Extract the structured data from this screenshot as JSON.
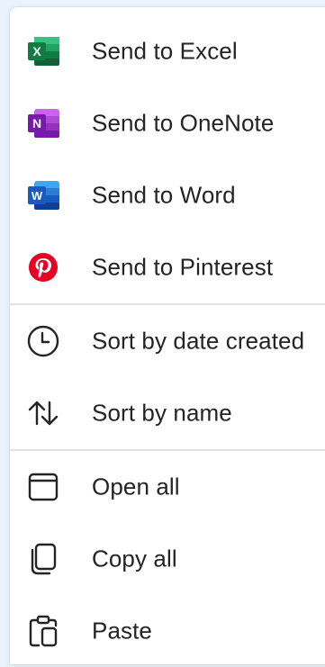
{
  "menu": {
    "items": [
      {
        "label": "Send to Excel",
        "icon": "excel-icon",
        "color": "#107c41"
      },
      {
        "label": "Send to OneNote",
        "icon": "onenote-icon",
        "color": "#7719aa"
      },
      {
        "label": "Send to Word",
        "icon": "word-icon",
        "color": "#185abd"
      },
      {
        "label": "Send to Pinterest",
        "icon": "pinterest-icon",
        "color": "#e60023"
      },
      {
        "label": "Sort by date created",
        "icon": "clock-icon"
      },
      {
        "label": "Sort by name",
        "icon": "sort-arrows-icon"
      },
      {
        "label": "Open all",
        "icon": "window-icon"
      },
      {
        "label": "Copy all",
        "icon": "copy-icon"
      },
      {
        "label": "Paste",
        "icon": "paste-icon"
      }
    ],
    "icon_letters": {
      "excel": "X",
      "onenote": "N",
      "word": "W"
    }
  }
}
